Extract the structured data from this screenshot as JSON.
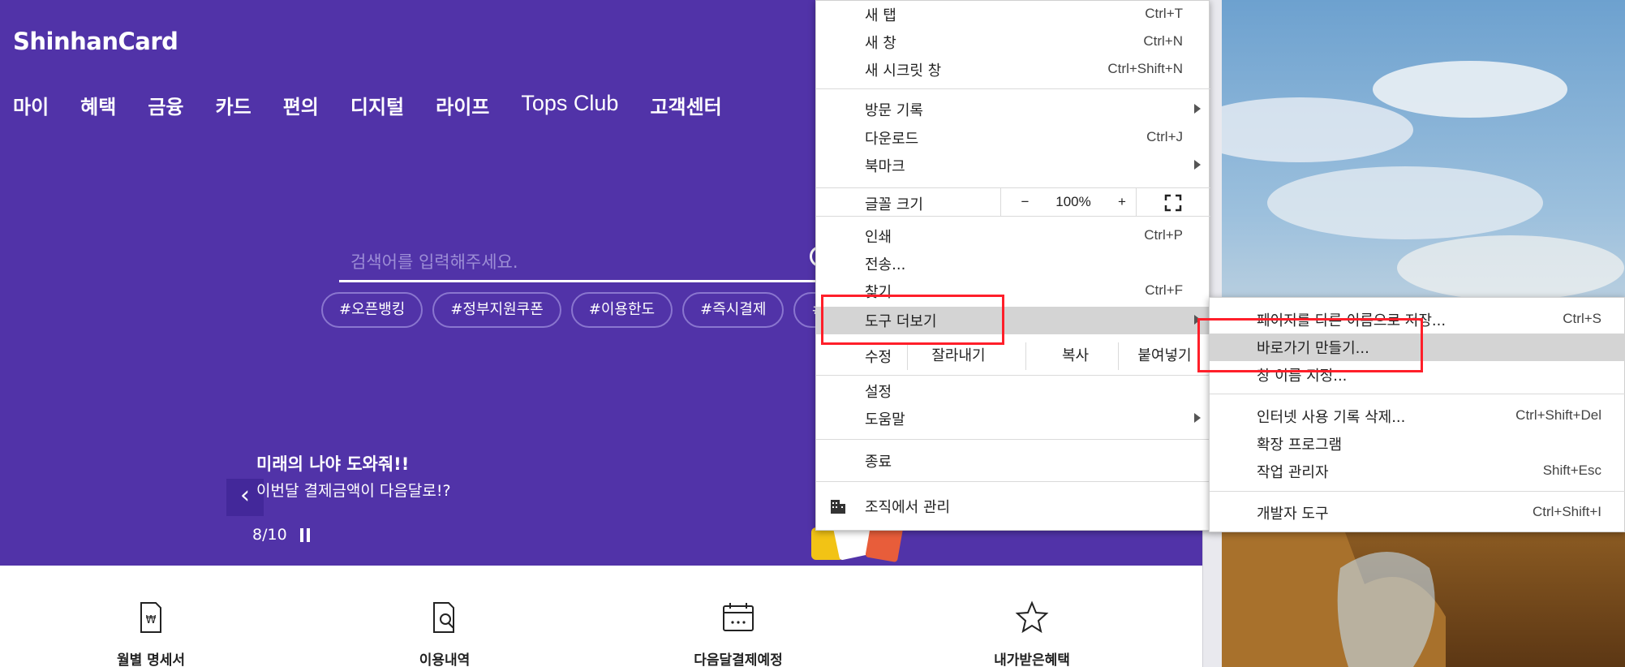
{
  "site": {
    "logo": "ShinhanCard",
    "nav": [
      "마이",
      "혜택",
      "금융",
      "카드",
      "편의",
      "디지털",
      "라이프",
      "Tops Club",
      "고객센터"
    ],
    "search_placeholder": "검색어를 입력해주세요.",
    "keywords": [
      "#오픈뱅킹",
      "#정부지원쿠폰",
      "#이용한도",
      "#즉시결제",
      "#리"
    ],
    "promo": {
      "title": "미래의 나야 도와줘!!",
      "subtitle": "이번달 결제금액이 다음달로!?",
      "counter": "8/10",
      "prev_icon": "chevron-left-icon",
      "pause_icon": "pause-icon"
    },
    "quick_menu": [
      {
        "label": "월별 명세서",
        "icon": "statement-icon"
      },
      {
        "label": "이용내역",
        "icon": "search-document-icon"
      },
      {
        "label": "다음달결제예정",
        "icon": "calendar-icon"
      },
      {
        "label": "내가받은혜택",
        "icon": "star-icon"
      }
    ],
    "colors": {
      "hero": "#5133a8",
      "accent_border": "#8a76cf"
    }
  },
  "chrome_menu": {
    "new_tab": {
      "label": "새 탭",
      "shortcut": "Ctrl+T"
    },
    "new_window": {
      "label": "새 창",
      "shortcut": "Ctrl+N"
    },
    "incognito": {
      "label": "새 시크릿 창",
      "shortcut": "Ctrl+Shift+N"
    },
    "history": {
      "label": "방문 기록"
    },
    "downloads": {
      "label": "다운로드",
      "shortcut": "Ctrl+J"
    },
    "bookmarks": {
      "label": "북마크"
    },
    "zoom": {
      "label": "글꼴 크기",
      "minus": "−",
      "value": "100%",
      "plus": "+",
      "fullscreen_icon": "fullscreen-icon"
    },
    "print": {
      "label": "인쇄",
      "shortcut": "Ctrl+P"
    },
    "cast": {
      "label": "전송..."
    },
    "find": {
      "label": "찾기...",
      "shortcut": "Ctrl+F"
    },
    "more_tools": {
      "label": "도구 더보기"
    },
    "edit": {
      "label": "수정",
      "cut": "잘라내기",
      "copy": "복사",
      "paste": "붙여넣기"
    },
    "settings": {
      "label": "설정"
    },
    "help": {
      "label": "도움말"
    },
    "exit": {
      "label": "종료"
    },
    "managed": {
      "label": "조직에서 관리",
      "icon": "building-icon"
    }
  },
  "sub_menu": {
    "save_page": {
      "label": "페이지를 다른 이름으로 저장...",
      "shortcut": "Ctrl+S"
    },
    "create_shortcut": {
      "label": "바로가기 만들기..."
    },
    "name_window": {
      "label": "창 이름 지정..."
    },
    "clear_data": {
      "label": "인터넷 사용 기록 삭제...",
      "shortcut": "Ctrl+Shift+Del"
    },
    "extensions": {
      "label": "확장 프로그램"
    },
    "task_manager": {
      "label": "작업 관리자",
      "shortcut": "Shift+Esc"
    },
    "devtools": {
      "label": "개발자 도구",
      "shortcut": "Ctrl+Shift+I"
    }
  }
}
